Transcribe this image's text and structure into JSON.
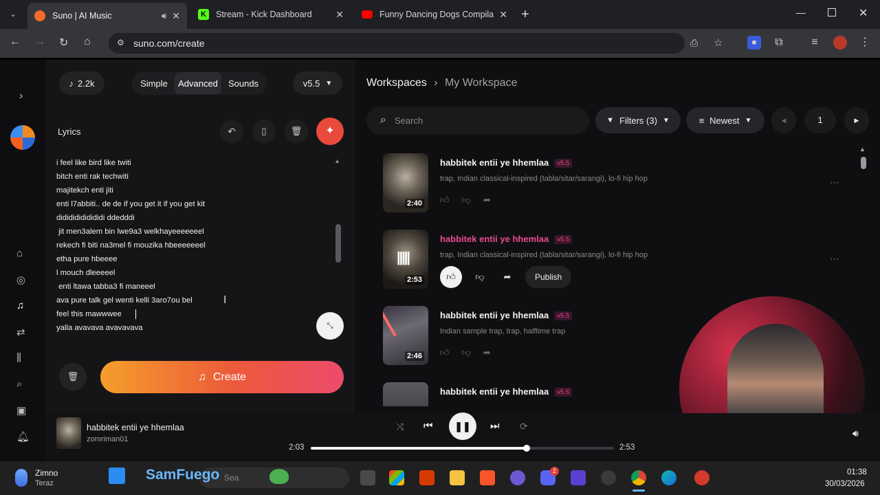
{
  "browser": {
    "tabs": [
      {
        "title": "Suno | AI Music",
        "active": true,
        "favicon_color": "#f26b2a"
      },
      {
        "title": "Stream - Kick Dashboard",
        "active": false,
        "favicon_color": "#53fc18"
      },
      {
        "title": "Funny Dancing Dogs Compilatio",
        "active": false,
        "favicon_color": "#ff0000"
      }
    ],
    "url": "suno.com/create"
  },
  "create": {
    "credits": "2.2k",
    "modes": [
      "Simple",
      "Advanced",
      "Sounds"
    ],
    "active_mode": "Advanced",
    "version": "v5.5",
    "lyrics_label": "Lyrics",
    "lyrics": [
      "i feel like bird like twiti",
      "bitch enti rak techwiti",
      "majitekch enti jiti",
      "enti l7abbiti.. de de if you get it if you get kit",
      "didididididididi ddedddi",
      " jit men3alem bin lwe9a3 welkhayeeeeeeel",
      "rekech fi biti na3mel fi mouzika hbeeeeeeel",
      "etha pure hbeeee",
      "l mouch dleeeeel",
      " enti ltawa tabba3 fi maneeel",
      "ava pure talk gel wenti kelli 3aro7ou bel",
      "feel this mawwwee",
      "yalla avavava avavavava"
    ],
    "create_label": "Create"
  },
  "workspace": {
    "breadcrumb_root": "Workspaces",
    "breadcrumb_current": "My Workspace",
    "search_placeholder": "Search",
    "filters_label": "Filters (3)",
    "sort_label": "Newest",
    "page": "1",
    "songs": [
      {
        "title": "habbitek entii ye hhemlaa",
        "version": "v5.5",
        "tags": "trap, Indian classical-inspired (tabla/sitar/sarangi), lo-fi hip hop",
        "duration": "2:40",
        "playing": false
      },
      {
        "title": "habbitek entii ye hhemlaa",
        "version": "v5.5",
        "tags": "trap, Indian classical-inspired (tabla/sitar/sarangi), lo-fi hip hop",
        "duration": "2:53",
        "playing": true,
        "publish_label": "Publish"
      },
      {
        "title": "habbitek entii ye hhemlaa",
        "version": "v5.5",
        "tags": "Indian sample trap, trap, halftime trap",
        "duration": "2:46",
        "playing": false
      },
      {
        "title": "habbitek entii ye hhemlaa",
        "version": "v5.5",
        "tags": "",
        "duration": "",
        "playing": false
      }
    ]
  },
  "player": {
    "title": "habbitek entii ye hhemlaa",
    "artist": "zomriman01",
    "elapsed": "2:03",
    "total": "2:53",
    "progress": 0.711
  },
  "taskbar": {
    "weather_title": "Zimno",
    "weather_sub": "Teraz",
    "overlay_text": "SamFuego",
    "search_placeholder": "Sea",
    "time": "01:38",
    "date": "30/03/2026",
    "discord_badge": "2"
  },
  "colors": {
    "accent_pink": "#e94a8f",
    "create_gradient_start": "#f59e2b",
    "create_gradient_end": "#ec4b6a"
  }
}
